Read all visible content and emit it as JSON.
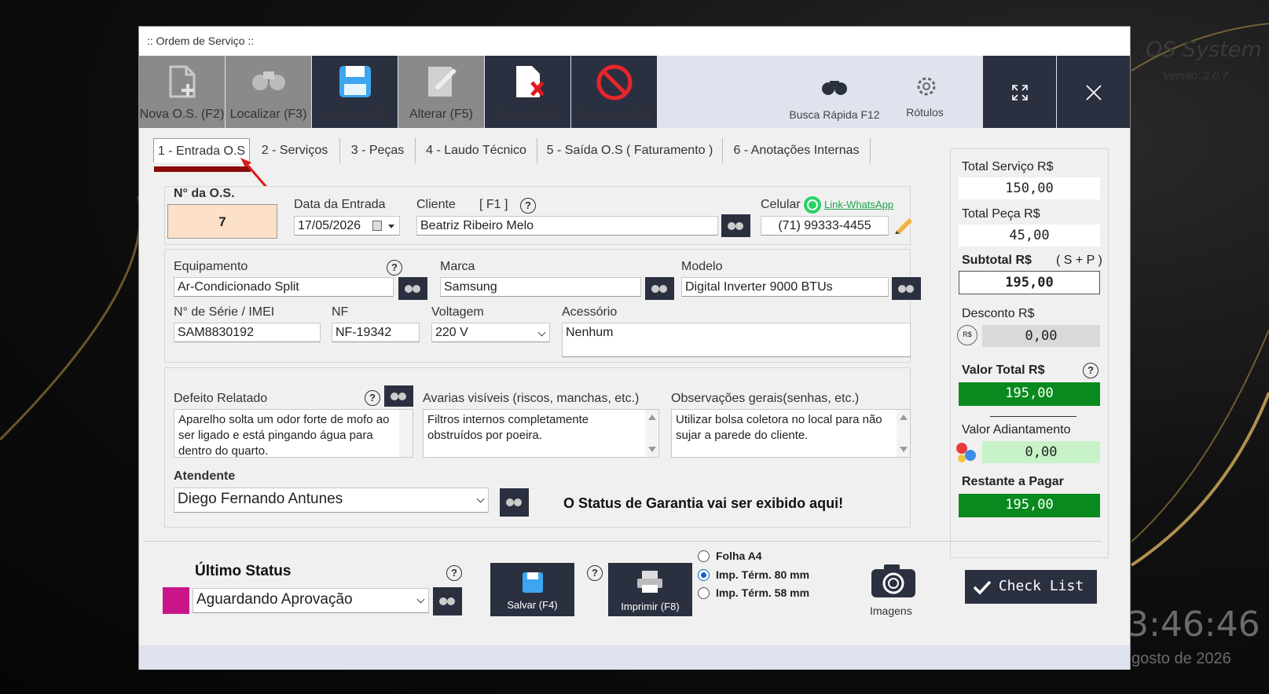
{
  "background": {
    "brand": "OS System",
    "version": "Versão: 2.0.7",
    "clock": "3:46:46",
    "date": "gosto de 2026"
  },
  "window": {
    "title": ":: Ordem de Serviço ::"
  },
  "toolbar": {
    "nova": "Nova O.S. (F2)",
    "localizar": "Localizar (F3)",
    "salvar": "Salvar (F4)",
    "alterar": "Alterar  (F5)",
    "excluir": "Excluir (F6)",
    "cancelar": "Cancelar (F7)",
    "busca": "Busca Rápida F12",
    "rotulos": "Rótulos"
  },
  "tabs": [
    {
      "label": "1 - Entrada O.S"
    },
    {
      "label": "2 - Serviços"
    },
    {
      "label": "3 - Peças"
    },
    {
      "label": "4 - Laudo Técnico"
    },
    {
      "label": "5 - Saída O.S ( Faturamento )"
    },
    {
      "label": "6 - Anotações Internas"
    }
  ],
  "entrada": {
    "os_label": "N° da O.S.",
    "os_number": "7",
    "data_label": "Data da Entrada",
    "data_value": "17/05/2026",
    "cliente_label": "Cliente",
    "cliente_hint": "[ F1 ]",
    "cliente_value": "Beatriz Ribeiro Melo",
    "celular_label": "Celular",
    "whatsapp_link": "Link-WhatsApp",
    "celular_value": "(71) 99333-4455"
  },
  "equipamento": {
    "equip_label": "Equipamento",
    "equip_value": "Ar-Condicionado Split",
    "marca_label": "Marca",
    "marca_value": "Samsung",
    "modelo_label": "Modelo",
    "modelo_value": "Digital Inverter 9000 BTUs",
    "serie_label": "N° de Série / IMEI",
    "serie_value": "SAM8830192",
    "nf_label": "NF",
    "nf_value": "NF-19342",
    "voltagem_label": "Voltagem",
    "voltagem_value": "220 V",
    "acessorio_label": "Acessório",
    "acessorio_value": "Nenhum"
  },
  "defeitos": {
    "defeito_label": "Defeito Relatado",
    "defeito_value": "Aparelho solta um odor forte de mofo ao ser ligado e está pingando água para dentro do quarto.",
    "avarias_label": "Avarias visíveis (riscos, manchas, etc.)",
    "avarias_value": "Filtros internos completamente obstruídos por poeira.",
    "obs_label": "Observações gerais(senhas, etc.)",
    "obs_value": "Utilizar bolsa coletora no local para não sujar a parede do cliente.",
    "atendente_label": "Atendente",
    "atendente_value": "Diego Fernando Antunes",
    "garantia_status": "O Status de Garantia vai ser exibido aqui!"
  },
  "totals": {
    "servico_label": "Total Serviço R$",
    "servico_value": "150,00",
    "peca_label": "Total Peça R$",
    "peca_value": "45,00",
    "subtotal_label": "Subtotal R$",
    "subtotal_hint": "( S + P )",
    "subtotal_value": "195,00",
    "desconto_label": "Desconto R$",
    "desconto_value": "0,00",
    "currency_badge": "R$",
    "valor_total_label": "Valor Total R$",
    "valor_total_value": "195,00",
    "adiantamento_label": "Valor Adiantamento",
    "adiantamento_value": "0,00",
    "restante_label": "Restante a Pagar",
    "restante_value": "195,00"
  },
  "bottom": {
    "ultimo_status_label": "Último Status",
    "status_value": "Aguardando Aprovação",
    "status_color": "#c8168a",
    "salvar": "Salvar (F4)",
    "imprimir": "Imprimir (F8)",
    "radio_a4": "Folha A4",
    "radio_80": "Imp. Térm. 80 mm",
    "radio_58": "Imp. Térm. 58 mm",
    "imagens": "Imagens",
    "checklist": "Check List"
  },
  "colors": {
    "dark": "#2b3040",
    "green": "#0a8a1e",
    "os_box": "#fce0c8",
    "adiantamento": "#c8f2c8",
    "tab_marker": "#8b0b0b"
  }
}
